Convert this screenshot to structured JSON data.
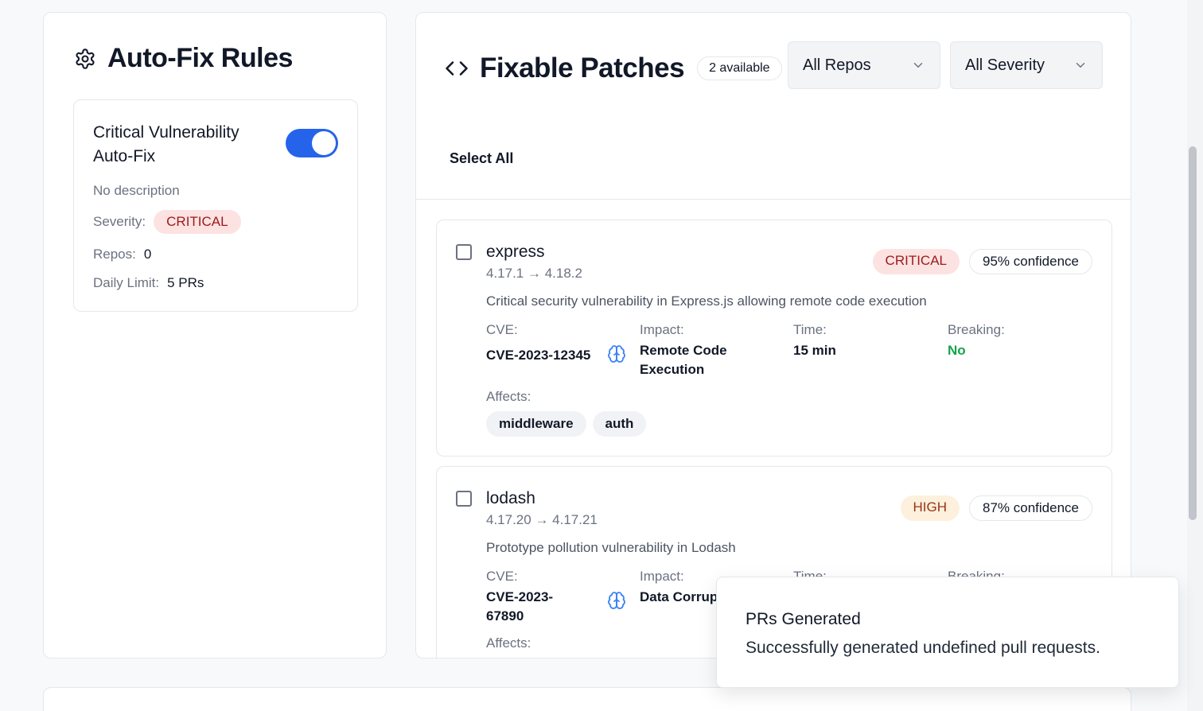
{
  "rules": {
    "title": "Auto-Fix Rules",
    "rule": {
      "name": "Critical Vulnerability Auto-Fix",
      "enabled": true,
      "description": "No description",
      "severity_label": "Severity:",
      "severity": "CRITICAL",
      "repos_label": "Repos:",
      "repos": "0",
      "daily_limit_label": "Daily Limit:",
      "daily_limit": "5 PRs"
    }
  },
  "patches": {
    "title": "Fixable Patches",
    "available": "2 available",
    "repo_filter": "All Repos",
    "severity_filter": "All Severity",
    "select_all": "Select All",
    "labels": {
      "cve": "CVE:",
      "impact": "Impact:",
      "time": "Time:",
      "breaking": "Breaking:",
      "affects": "Affects:"
    },
    "items": [
      {
        "name": "express",
        "version": "4.17.1 → 4.18.2",
        "severity": "CRITICAL",
        "confidence": "95% confidence",
        "description": "Critical security vulnerability in Express.js allowing remote code execution",
        "cve": "CVE-2023-12345",
        "impact": "Remote Code Execution",
        "time": "15 min",
        "breaking": "No",
        "affects": [
          "middleware",
          "auth"
        ]
      },
      {
        "name": "lodash",
        "version": "4.17.20 → 4.17.21",
        "severity": "HIGH",
        "confidence": "87% confidence",
        "description": "Prototype pollution vulnerability in Lodash",
        "cve": "CVE-2023-67890",
        "impact": "Data Corrup"
      }
    ]
  },
  "toast": {
    "title": "PRs Generated",
    "message": "Successfully generated undefined pull requests."
  },
  "colors": {
    "accent": "#2563eb",
    "critical_bg": "#fde2e2",
    "critical_text": "#991b1b",
    "high_bg": "#fdf0dc",
    "high_text": "#9a3412",
    "success": "#16a34a"
  }
}
